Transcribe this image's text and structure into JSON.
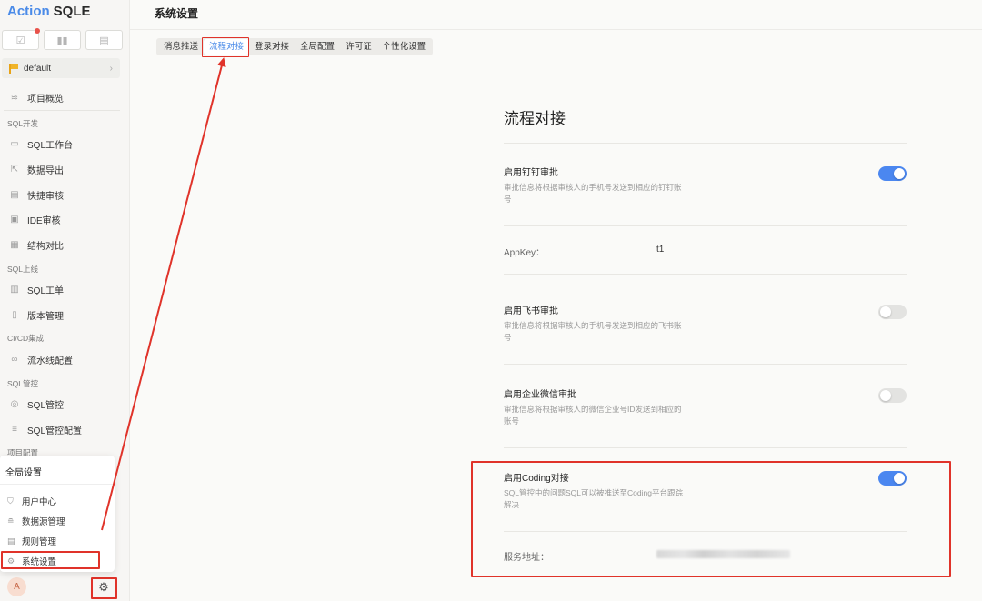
{
  "app": {
    "logo_part1": "Action",
    "logo_part2": "SQLE"
  },
  "sidebar": {
    "project": "default",
    "overview": "项目概览",
    "sections": [
      {
        "title": "SQL开发",
        "items": [
          "SQL工作台",
          "数据导出",
          "快捷审核",
          "IDE审核",
          "结构对比"
        ]
      },
      {
        "title": "SQL上线",
        "items": [
          "SQL工单",
          "版本管理"
        ]
      },
      {
        "title": "CI/CD集成",
        "items": [
          "流水线配置"
        ]
      },
      {
        "title": "SQL管控",
        "items": [
          "SQL管控",
          "SQL管控配置"
        ]
      },
      {
        "title": "项目配置",
        "items": []
      }
    ],
    "avatar": "A"
  },
  "popup": {
    "title": "全局设置",
    "items": [
      "用户中心",
      "数据源管理",
      "规则管理",
      "系统设置"
    ]
  },
  "header": {
    "title": "系统设置"
  },
  "tabs": [
    "消息推送",
    "流程对接",
    "登录对接",
    "全局配置",
    "许可证",
    "个性化设置"
  ],
  "active_tab": "流程对接",
  "page": {
    "heading": "流程对接",
    "settings": [
      {
        "title": "启用钉钉审批",
        "desc": "审批信息将根据审核人的手机号发送到相应的钉钉账号",
        "enabled": true
      },
      {
        "title": "启用飞书审批",
        "desc": "审批信息将根据审核人的手机号发送到相应的飞书账号",
        "enabled": false
      },
      {
        "title": "启用企业微信审批",
        "desc": "审批信息将根据审核人的微信企业号ID发送到相应的账号",
        "enabled": false
      },
      {
        "title": "启用Coding对接",
        "desc": "SQL管控中的问题SQL可以被推送至Coding平台跟踪解决",
        "enabled": true
      }
    ],
    "appkey_label": "AppKey：",
    "appkey_value": "t1",
    "service_label": "服务地址："
  },
  "colors": {
    "accent": "#4b87f0",
    "annotation_red": "#e0332a"
  }
}
